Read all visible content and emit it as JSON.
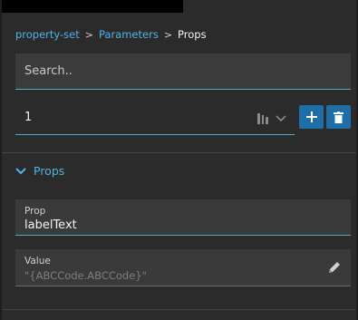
{
  "breadcrumb": {
    "items": [
      "property-set",
      "Parameters"
    ],
    "separator": ">",
    "current": "Props"
  },
  "search": {
    "placeholder": "Search.."
  },
  "selector": {
    "value": "1"
  },
  "section": {
    "title": "Props"
  },
  "prop_field": {
    "label": "Prop",
    "value": "labelText"
  },
  "value_field": {
    "label": "Value",
    "placeholder": "\"{ABCCode.ABCCode}\""
  },
  "colors": {
    "accent": "#4fb3e6",
    "button": "#1f6fa6",
    "background": "#2b2b2b",
    "field": "#3a3a3a"
  }
}
